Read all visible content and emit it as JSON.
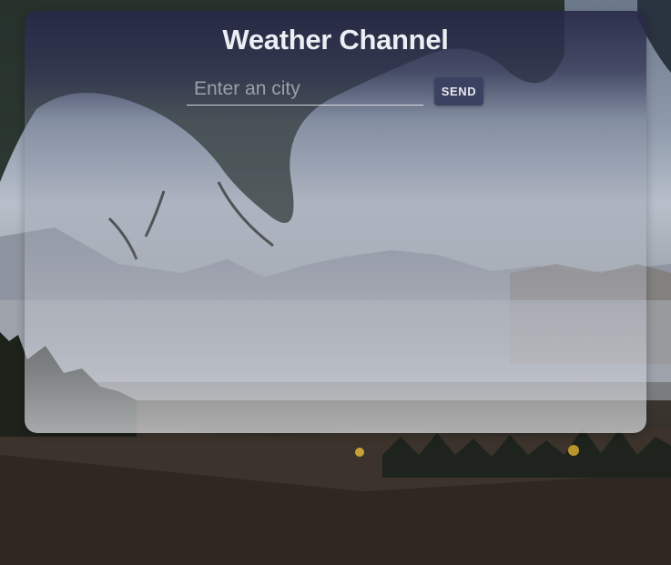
{
  "app": {
    "title": "Weather Channel"
  },
  "search": {
    "value": "",
    "placeholder": "Enter an city"
  },
  "actions": {
    "send_label": "SEND"
  },
  "background": {
    "icon": "landscape-photo",
    "accent": "#3b4160"
  }
}
